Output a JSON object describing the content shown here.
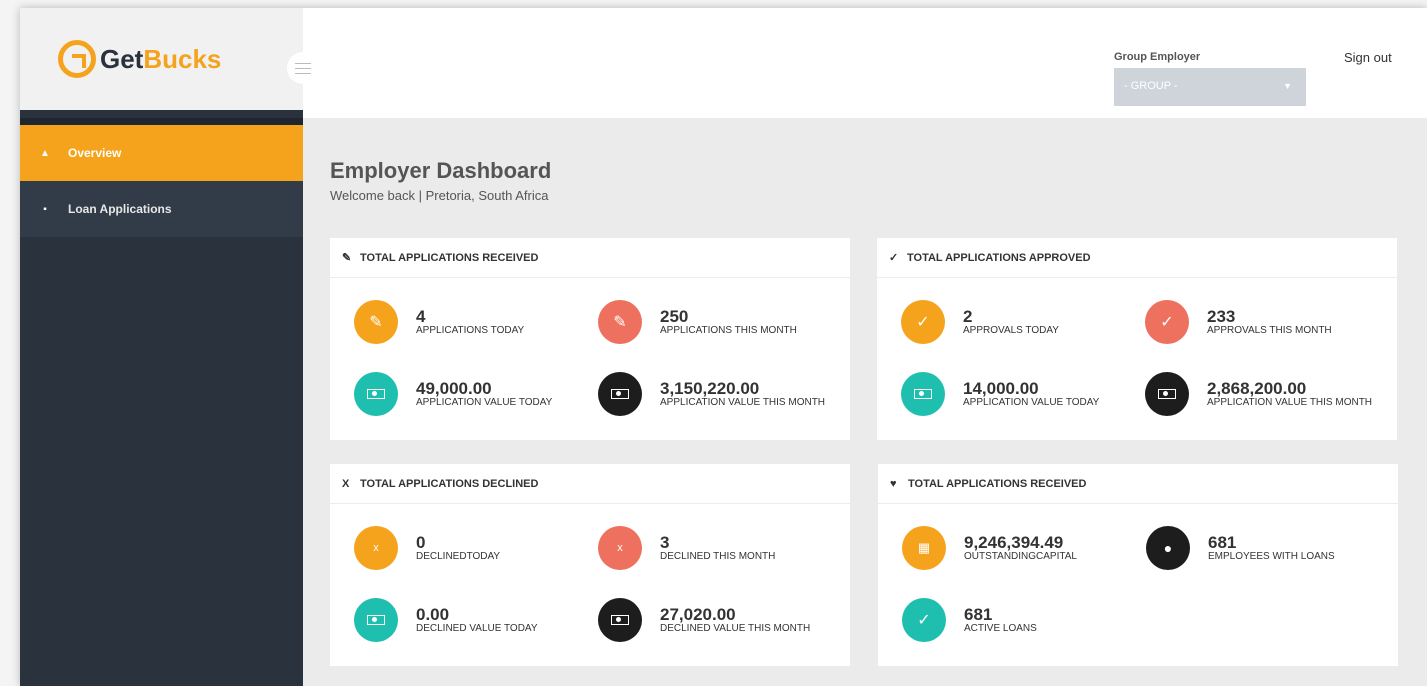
{
  "brand": {
    "get": "Get",
    "bucks": "Bucks"
  },
  "sidebar": {
    "items": [
      {
        "label": "Overview",
        "icon": "dashboard-icon",
        "active": true
      },
      {
        "label": "Loan Applications",
        "icon": "money-icon",
        "active": false
      }
    ]
  },
  "header": {
    "group_label": "Group Employer",
    "group_value": "- GROUP -",
    "sign_out": "Sign out"
  },
  "page": {
    "title": "Employer Dashboard",
    "subtitle": "Welcome back | Pretoria, South Africa"
  },
  "colors": {
    "orange": "#f5a31c",
    "red": "#ee705e",
    "teal": "#1fbfb0",
    "black": "#1d1d1d",
    "sidebar": "#29323d"
  },
  "cards": {
    "received": {
      "title": "TOTAL APPLICATIONS RECEIVED",
      "icon": "pencil-icon",
      "stats": [
        {
          "value": "4",
          "label": "APPLICATIONS TODAY"
        },
        {
          "value": "250",
          "label": "APPLICATIONS THIS MONTH"
        },
        {
          "value": "49,000.00",
          "label": "APPLICATION VALUE TODAY"
        },
        {
          "value": "3,150,220.00",
          "label": "APPLICATION VALUE THIS MONTH"
        }
      ]
    },
    "approved": {
      "title": "TOTAL APPLICATIONS APPROVED",
      "icon": "check-icon",
      "stats": [
        {
          "value": "2",
          "label": "APPROVALS TODAY"
        },
        {
          "value": "233",
          "label": "APPROVALS THIS MONTH"
        },
        {
          "value": "14,000.00",
          "label": "APPLICATION VALUE TODAY"
        },
        {
          "value": "2,868,200.00",
          "label": "APPLICATION VALUE THIS MONTH"
        }
      ]
    },
    "declined": {
      "title": "TOTAL APPLICATIONS DECLINED",
      "icon": "x-icon",
      "stats": [
        {
          "value": "0",
          "label": "DECLINEDTODAY"
        },
        {
          "value": "3",
          "label": "DECLINED THIS MONTH"
        },
        {
          "value": "0.00",
          "label": "DECLINED VALUE TODAY"
        },
        {
          "value": "27,020.00",
          "label": "DECLINED VALUE THIS MONTH"
        }
      ]
    },
    "loans": {
      "title": "TOTAL APPLICATIONS RECEIVED",
      "icon": "heart-icon",
      "stats": [
        {
          "value": "9,246,394.49",
          "label": "OUTSTANDINGCAPITAL"
        },
        {
          "value": "681",
          "label": "EMPLOYEES WITH LOANS"
        },
        {
          "value": "681",
          "label": "ACTIVE LOANS"
        }
      ]
    }
  }
}
